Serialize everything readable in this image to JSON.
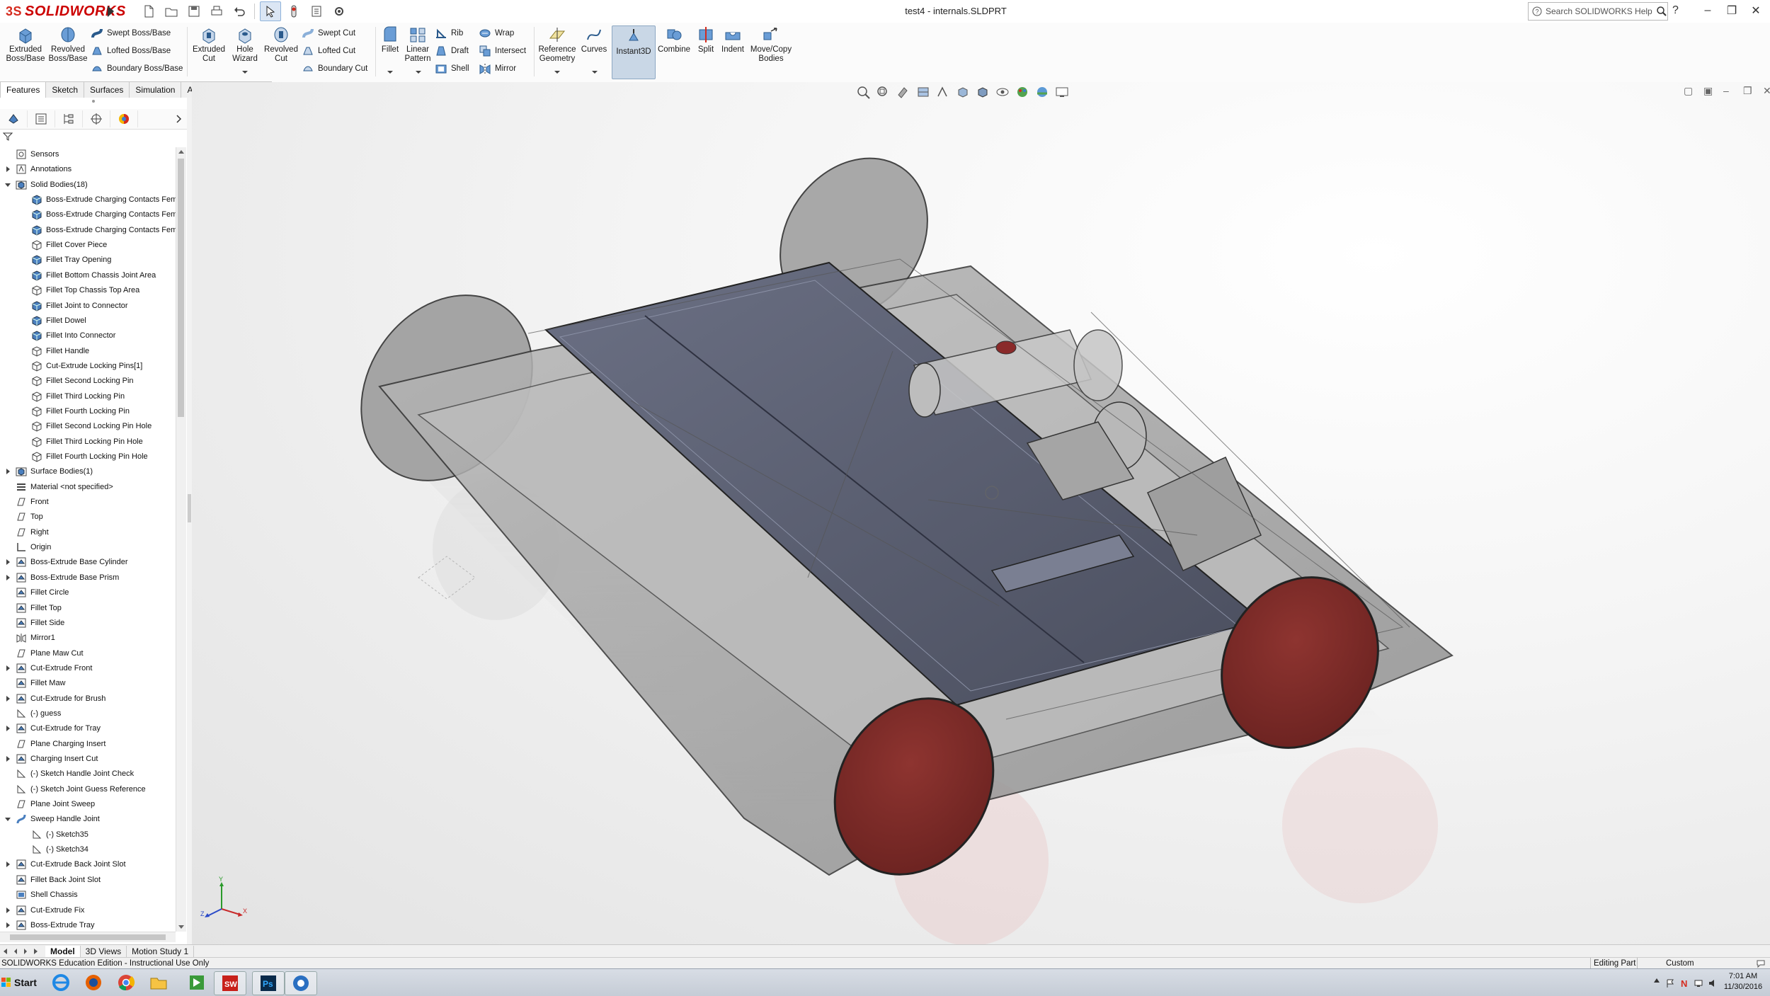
{
  "app": {
    "brand_ds": "3S",
    "brand_name": "SOLIDWORKS",
    "document_title": "test4 - internals.SLDPRT",
    "search_placeholder": "Search SOLIDWORKS Help",
    "help_label": "?"
  },
  "quick_access": [
    {
      "name": "new-icon"
    },
    {
      "name": "open-icon"
    },
    {
      "name": "save-icon"
    },
    {
      "name": "print-icon"
    },
    {
      "name": "undo-icon"
    },
    {
      "name": "select-icon"
    },
    {
      "name": "rebuild-icon"
    },
    {
      "name": "file-properties-icon"
    },
    {
      "name": "options-icon"
    }
  ],
  "command_manager": {
    "extruded_boss": "Extruded Boss/Base",
    "revolved_boss": "Revolved Boss/Base",
    "swept_boss": "Swept Boss/Base",
    "lofted_boss": "Lofted Boss/Base",
    "boundary_boss": "Boundary Boss/Base",
    "extruded_cut": "Extruded Cut",
    "hole_wizard": "Hole Wizard",
    "revolved_cut": "Revolved Cut",
    "swept_cut": "Swept Cut",
    "lofted_cut": "Lofted Cut",
    "boundary_cut": "Boundary Cut",
    "fillet": "Fillet",
    "linear_pattern": "Linear Pattern",
    "rib": "Rib",
    "draft": "Draft",
    "shell": "Shell",
    "wrap": "Wrap",
    "intersect": "Intersect",
    "mirror": "Mirror",
    "reference_geometry": "Reference Geometry",
    "curves": "Curves",
    "instant3d": "Instant3D",
    "combine": "Combine",
    "split": "Split",
    "indent": "Indent",
    "move_copy": "Move/Copy Bodies"
  },
  "cmd_tabs": [
    "Features",
    "Sketch",
    "Surfaces",
    "Simulation",
    "Analysis Preparation"
  ],
  "feature_tree": [
    {
      "label": "Sensors",
      "icon": "sensor-icon",
      "level": 0,
      "expander": false
    },
    {
      "label": "Annotations",
      "icon": "annotations-icon",
      "level": 0,
      "expander": true
    },
    {
      "label": "Solid Bodies(18)",
      "icon": "solid-bodies-folder-icon",
      "level": 0,
      "expander": true,
      "open": true
    },
    {
      "label": "Boss-Extrude Charging Contacts Fema",
      "icon": "solid-body-icon",
      "level": 1
    },
    {
      "label": "Boss-Extrude Charging Contacts Fema",
      "icon": "solid-body-icon",
      "level": 1
    },
    {
      "label": "Boss-Extrude Charging Contacts Fema",
      "icon": "solid-body-icon",
      "level": 1
    },
    {
      "label": "Fillet Cover Piece",
      "icon": "fillet-body-icon",
      "level": 1
    },
    {
      "label": "Fillet Tray Opening",
      "icon": "solid-body-icon",
      "level": 1
    },
    {
      "label": "Fillet Bottom Chassis Joint Area",
      "icon": "solid-body-icon",
      "level": 1
    },
    {
      "label": "Fillet Top Chassis Top Area",
      "icon": "fillet-body-icon",
      "level": 1
    },
    {
      "label": "Fillet Joint to Connector",
      "icon": "solid-body-icon",
      "level": 1
    },
    {
      "label": "Fillet Dowel",
      "icon": "solid-body-icon",
      "level": 1
    },
    {
      "label": "Fillet Into Connector",
      "icon": "solid-body-icon",
      "level": 1
    },
    {
      "label": "Fillet Handle",
      "icon": "fillet-body-icon",
      "level": 1
    },
    {
      "label": "Cut-Extrude Locking Pins[1]",
      "icon": "fillet-body-icon",
      "level": 1
    },
    {
      "label": "Fillet Second Locking Pin",
      "icon": "fillet-body-icon",
      "level": 1
    },
    {
      "label": "Fillet Third Locking Pin",
      "icon": "fillet-body-icon",
      "level": 1
    },
    {
      "label": "Fillet Fourth Locking Pin",
      "icon": "fillet-body-icon",
      "level": 1
    },
    {
      "label": "Fillet Second Locking Pin Hole",
      "icon": "fillet-body-icon",
      "level": 1
    },
    {
      "label": "Fillet Third Locking Pin Hole",
      "icon": "fillet-body-icon",
      "level": 1
    },
    {
      "label": "Fillet Fourth Locking Pin Hole",
      "icon": "fillet-body-icon",
      "level": 1
    },
    {
      "label": "Surface Bodies(1)",
      "icon": "surface-bodies-folder-icon",
      "level": 0,
      "expander": true
    },
    {
      "label": "Material <not specified>",
      "icon": "material-icon",
      "level": 0
    },
    {
      "label": "Front",
      "icon": "plane-icon",
      "level": 0
    },
    {
      "label": "Top",
      "icon": "plane-icon",
      "level": 0
    },
    {
      "label": "Right",
      "icon": "plane-icon",
      "level": 0
    },
    {
      "label": "Origin",
      "icon": "origin-icon",
      "level": 0
    },
    {
      "label": "Boss-Extrude Base Cylinder",
      "icon": "extrude-feature-icon",
      "level": 0,
      "expander": true
    },
    {
      "label": "Boss-Extrude Base Prism",
      "icon": "extrude-feature-icon",
      "level": 0,
      "expander": true
    },
    {
      "label": "Fillet Circle",
      "icon": "fillet-feature-icon",
      "level": 0
    },
    {
      "label": "Fillet Top",
      "icon": "fillet-feature-icon",
      "level": 0
    },
    {
      "label": "Fillet Side",
      "icon": "fillet-feature-icon",
      "level": 0
    },
    {
      "label": "Mirror1",
      "icon": "mirror-feature-icon",
      "level": 0
    },
    {
      "label": "Plane Maw Cut",
      "icon": "plane-icon",
      "level": 0
    },
    {
      "label": "Cut-Extrude Front",
      "icon": "cut-feature-icon",
      "level": 0,
      "expander": true
    },
    {
      "label": "Fillet Maw",
      "icon": "fillet-feature-icon",
      "level": 0
    },
    {
      "label": "Cut-Extrude for Brush",
      "icon": "cut-feature-icon",
      "level": 0,
      "expander": true
    },
    {
      "label": "(-) guess",
      "icon": "sketch-icon",
      "level": 0
    },
    {
      "label": "Cut-Extrude for Tray",
      "icon": "cut-feature-icon",
      "level": 0,
      "expander": true
    },
    {
      "label": "Plane Charging Insert",
      "icon": "plane-icon",
      "level": 0
    },
    {
      "label": "Charging Insert Cut",
      "icon": "cut-feature-icon",
      "level": 0,
      "expander": true
    },
    {
      "label": "(-) Sketch Handle Joint Check",
      "icon": "sketch-icon",
      "level": 0
    },
    {
      "label": "(-) Sketch Joint Guess Reference",
      "icon": "sketch-icon",
      "level": 0
    },
    {
      "label": "Plane Joint Sweep",
      "icon": "plane-icon",
      "level": 0
    },
    {
      "label": "Sweep Handle Joint",
      "icon": "sweep-feature-icon",
      "level": 0,
      "expander": true,
      "open": true
    },
    {
      "label": "(-) Sketch35",
      "icon": "sketch-icon",
      "level": 1
    },
    {
      "label": "(-) Sketch34",
      "icon": "sketch-icon",
      "level": 1
    },
    {
      "label": "Cut-Extrude Back Joint Slot",
      "icon": "cut-feature-icon",
      "level": 0,
      "expander": true
    },
    {
      "label": "Fillet Back Joint Slot",
      "icon": "fillet-feature-icon",
      "level": 0
    },
    {
      "label": "Shell Chassis",
      "icon": "shell-feature-icon",
      "level": 0
    },
    {
      "label": "Cut-Extrude Fix",
      "icon": "cut-feature-icon",
      "level": 0,
      "expander": true
    },
    {
      "label": "Boss-Extrude Tray",
      "icon": "extrude-feature-icon",
      "level": 0,
      "expander": true
    }
  ],
  "bottom_tabs": [
    "Model",
    "3D Views",
    "Motion Study 1"
  ],
  "status": {
    "left": "SOLIDWORKS Education Edition - Instructional Use Only",
    "editing": "Editing Part",
    "units": "Custom"
  },
  "taskbar": {
    "start": "Start",
    "apps": [
      {
        "name": "ie-icon",
        "running": false
      },
      {
        "name": "firefox-icon",
        "running": false
      },
      {
        "name": "chrome-icon",
        "running": false
      },
      {
        "name": "file-explorer-icon",
        "running": false
      },
      {
        "name": "green-app-icon",
        "running": false
      },
      {
        "name": "solidworks-taskbar-icon",
        "running": true
      },
      {
        "name": "photoshop-icon",
        "running": true
      },
      {
        "name": "blue-gear-app-icon",
        "running": true
      }
    ],
    "time": "7:01 AM",
    "date": "11/30/2016"
  },
  "colors": {
    "accent_red": "#d52b1e",
    "body_gray": "#9a9a9a",
    "tray_blue": "#555a6b",
    "wheel_red": "#7a2a28"
  }
}
